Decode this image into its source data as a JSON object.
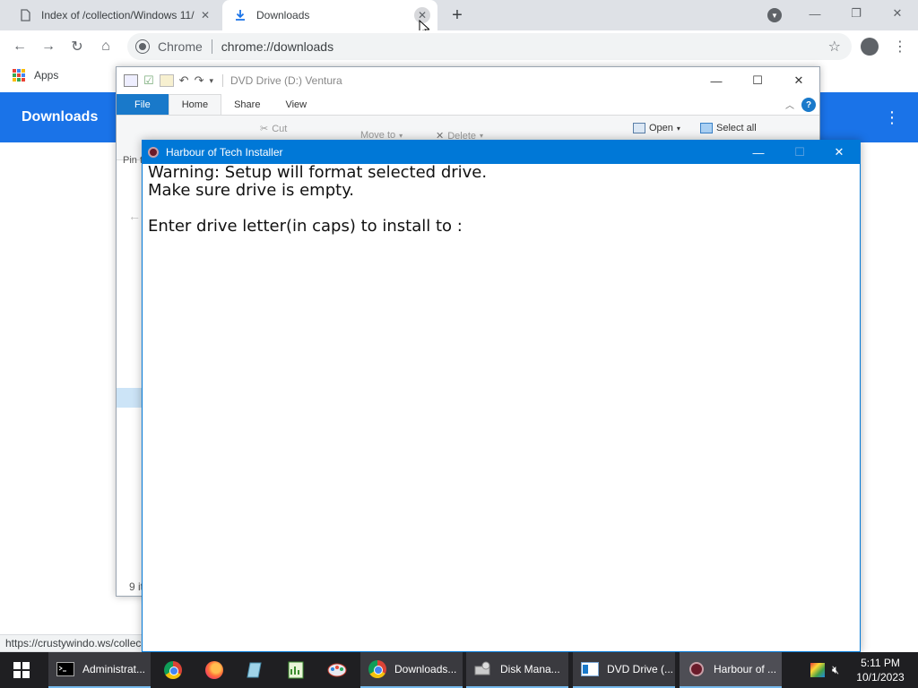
{
  "browser": {
    "tabs": [
      {
        "title": "Index of /collection/Windows 11/",
        "active": false
      },
      {
        "title": "Downloads",
        "active": true
      }
    ],
    "new_tab_icon": "plus-icon",
    "omnibox": {
      "site_label": "Chrome",
      "url": "chrome://downloads"
    },
    "bookmarks": {
      "apps_label": "Apps"
    },
    "page_header": "Downloads",
    "status_url": "https://crustywindo.ws/collec"
  },
  "explorer": {
    "title": "DVD Drive (D:) Ventura",
    "ribbon_tabs": [
      "File",
      "Home",
      "Share",
      "View"
    ],
    "ribbon": {
      "cut": "Cut",
      "move_to": "Move to",
      "delete": "Delete",
      "open": "Open",
      "select_all": "Select all"
    },
    "side_pin": "Pin t",
    "item_count": "9 it"
  },
  "installer": {
    "title": "Harbour of Tech Installer",
    "lines": [
      "Warning: Setup will format selected drive.",
      "Make sure drive is empty.",
      "",
      "Enter drive letter(in caps) to install to :"
    ]
  },
  "taskbar": {
    "items": [
      {
        "label": "Administrat..."
      },
      {
        "label": "Downloads..."
      },
      {
        "label": "Disk Mana..."
      },
      {
        "label": "DVD Drive (..."
      },
      {
        "label": "Harbour of ..."
      }
    ],
    "time": "5:11 PM",
    "date": "10/1/2023"
  },
  "colors": {
    "chrome_accent": "#1a73e8",
    "installer_title_bar": "#0078d7",
    "explorer_file_tab": "#1979ca",
    "taskbar": "#1f1f22"
  }
}
